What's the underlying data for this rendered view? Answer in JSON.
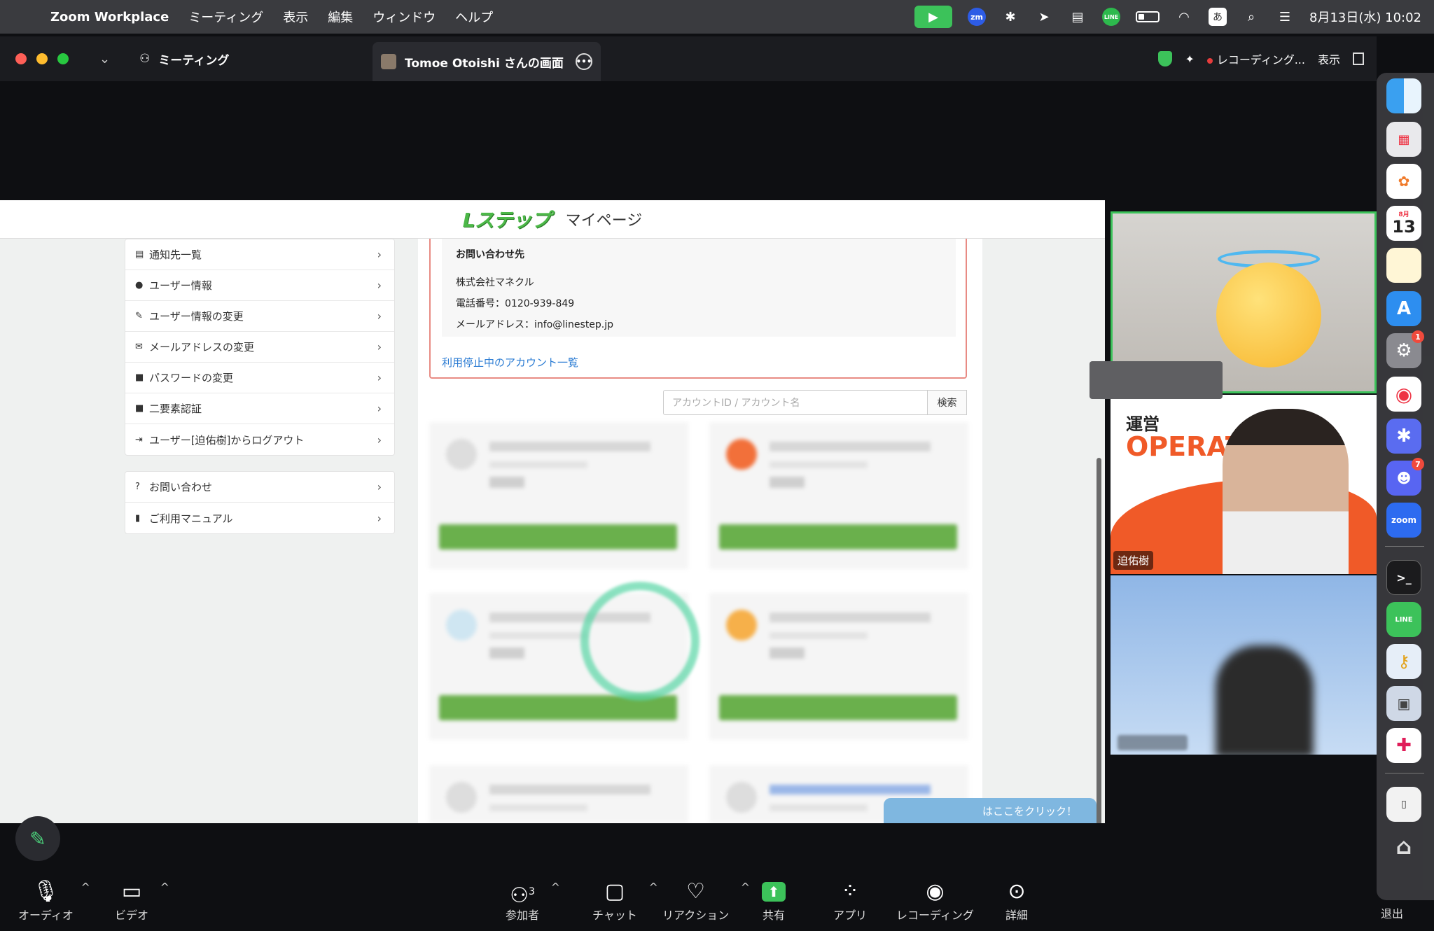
{
  "menubar": {
    "app_name": "Zoom Workplace",
    "menus": [
      "ミーティング",
      "表示",
      "編集",
      "ウィンドウ",
      "ヘルプ"
    ],
    "zm_label": "zm",
    "line_label": "LINE",
    "ime_label": "あ",
    "clock": "8月13日(水) 10:02"
  },
  "window": {
    "meeting_tab": "ミーティング",
    "share_tab": "Tomoe Otoishi さんの画面",
    "recording": "レコーディング...",
    "view_label": "表示"
  },
  "shared_screen": {
    "logo": "Lステップ",
    "page_title": "マイページ",
    "menu_primary": [
      {
        "icon": "▤",
        "label": "通知先一覧"
      },
      {
        "icon": "●",
        "label": "ユーザー情報"
      },
      {
        "icon": "✎",
        "label": "ユーザー情報の変更"
      },
      {
        "icon": "✉",
        "label": "メールアドレスの変更"
      },
      {
        "icon": "■",
        "label": "パスワードの変更"
      },
      {
        "icon": "■",
        "label": "二要素認証"
      },
      {
        "icon": "⇥",
        "label": "ユーザー[迫佑樹]からログアウト"
      }
    ],
    "menu_secondary": [
      {
        "icon": "?",
        "label": "お問い合わせ"
      },
      {
        "icon": "▮",
        "label": "ご利用マニュアル"
      }
    ],
    "contact": {
      "title": "お問い合わせ先",
      "company": "株式会社マネクル",
      "phone": "電話番号：0120-939-849",
      "email": "メールアドレス：info@linestep.jp"
    },
    "suspended_link": "利用停止中のアカウント一覧",
    "search_placeholder": "アカウントID / アカウント名",
    "search_button": "検索",
    "chat_banner": "はここをクリック！"
  },
  "gallery": {
    "tile2_text1": "運営",
    "tile2_text2": "OPERATO",
    "tile2_name": "迫佑樹"
  },
  "dock": {
    "calendar_month": "8月",
    "calendar_day": "13",
    "settings_badge": "1",
    "discord_badge": "7",
    "zoom_label": "zoom",
    "line_label": "LINE"
  },
  "toolbar": {
    "audio": "オーディオ",
    "video": "ビデオ",
    "participants": "参加者",
    "participant_count": "3",
    "chat": "チャット",
    "reaction": "リアクション",
    "share": "共有",
    "apps": "アプリ",
    "recording": "レコーディング",
    "more": "詳細",
    "exit": "退出"
  }
}
